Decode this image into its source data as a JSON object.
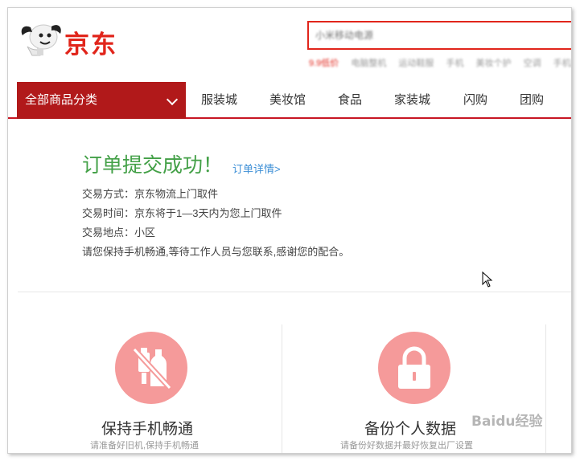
{
  "header": {
    "logo_text": "京东",
    "search_placeholder": "小米移动电源",
    "hot_words": [
      "9.9低价",
      "电脑整机",
      "运动鞋服",
      "手机",
      "美妆个护",
      "空调",
      "手机配件"
    ]
  },
  "nav": {
    "category_label": "全部商品分类",
    "items": [
      "服装城",
      "美妆馆",
      "食品",
      "家装城",
      "闪购",
      "团购"
    ]
  },
  "order": {
    "title": "订单提交成功！",
    "detail_link": "订单详情>",
    "lines": [
      "交易方式：京东物流上门取件",
      "交易时间：京东将于1—3天内为您上门取件",
      "交易地点：小区",
      "请您保持手机畅通,等待工作人员与您联系,感谢您的配合。"
    ]
  },
  "cards": [
    {
      "title": "保持手机畅通",
      "subtitle": "请准备好旧机,保持手机畅通",
      "icon": "phone-bottle-crossed-icon"
    },
    {
      "title": "备份个人数据",
      "subtitle": "请备份好数据并最好恢复出厂设置",
      "icon": "lock-icon"
    }
  ],
  "watermark": "Baidu经验",
  "colors": {
    "brand_red": "#e1251b",
    "category_bg": "#b1191a",
    "success_green": "#43a047",
    "link_blue": "#3d8fd6",
    "icon_circle": "#f59a9a"
  }
}
